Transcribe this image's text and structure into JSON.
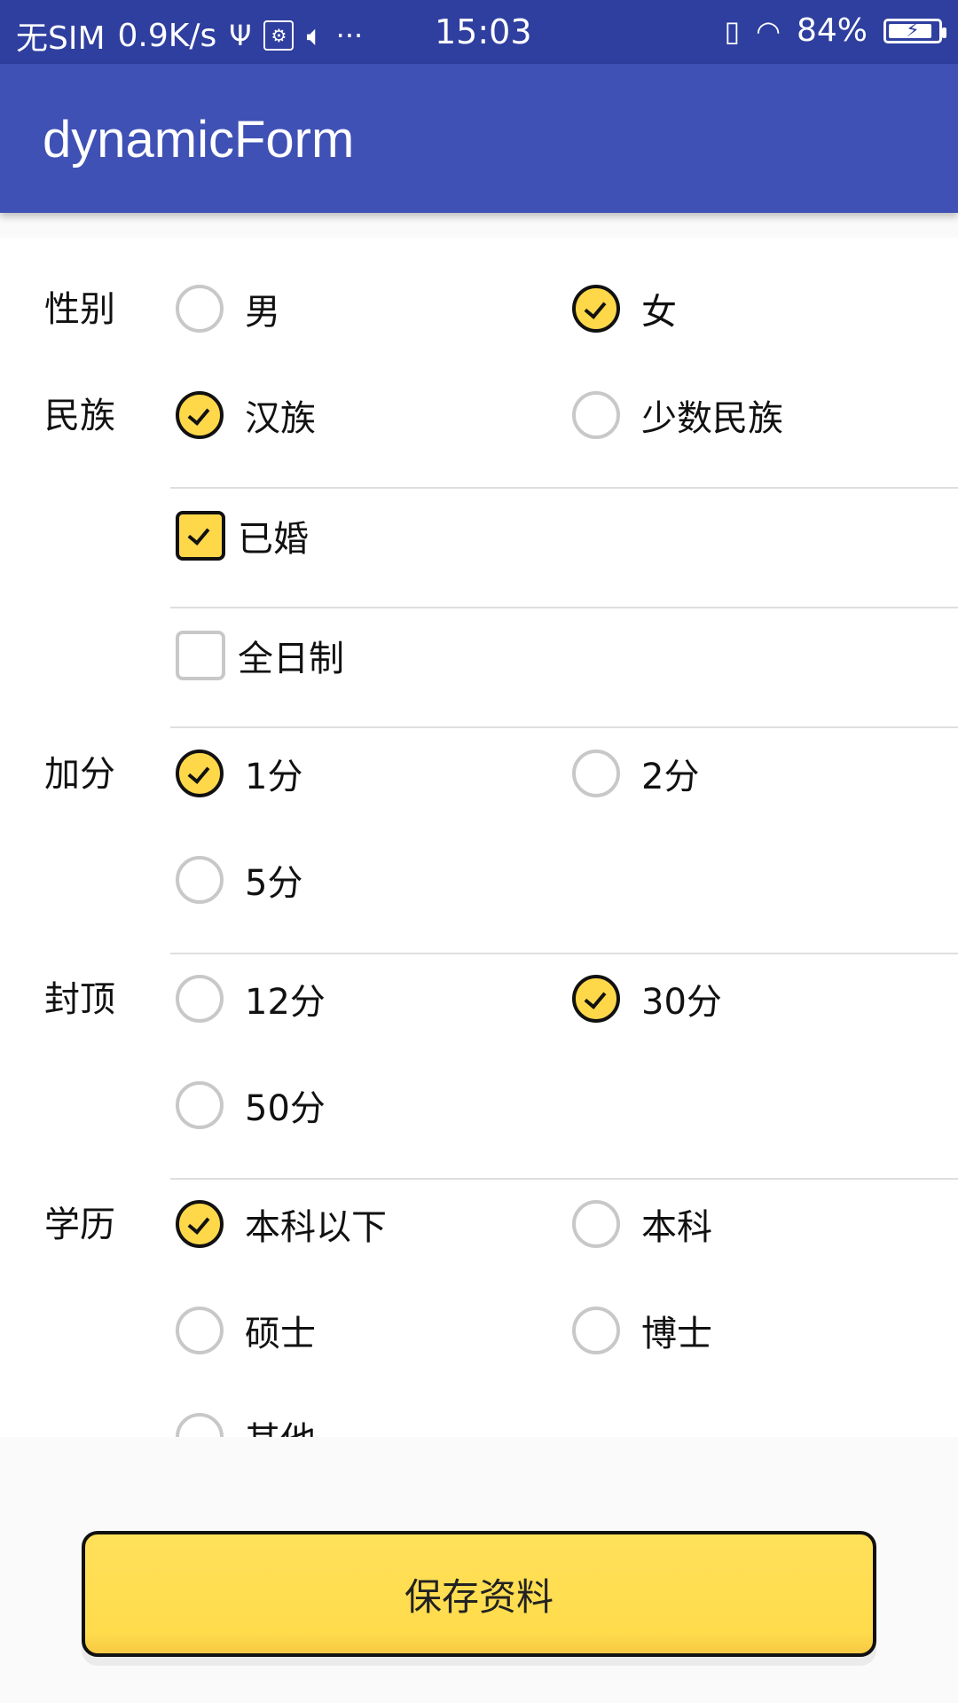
{
  "status_bar": {
    "carrier": "无SIM",
    "speed": "0.9K/s",
    "time": "15:03",
    "battery": "84%",
    "battery_level": 0.84,
    "icons": [
      "usb-icon",
      "usb-debug-icon",
      "volume-icon",
      "more-icon",
      "vibrate-icon",
      "wifi-icon",
      "battery-icon"
    ]
  },
  "app_bar": {
    "title": "dynamicForm"
  },
  "form": {
    "gender": {
      "label": "性别",
      "options": [
        "男",
        "女"
      ],
      "selected": "女"
    },
    "ethnicity": {
      "label": "民族",
      "options": [
        "汉族",
        "少数民族"
      ],
      "selected": "汉族"
    },
    "married": {
      "label": "已婚",
      "checked": true
    },
    "fulltime": {
      "label": "全日制",
      "checked": false
    },
    "bonus": {
      "label": "加分",
      "options": [
        "1分",
        "2分",
        "5分"
      ],
      "selected": "1分"
    },
    "cap": {
      "label": "封顶",
      "options": [
        "12分",
        "30分",
        "50分"
      ],
      "selected": "30分"
    },
    "education": {
      "label": "学历",
      "options": [
        "本科以下",
        "本科",
        "硕士",
        "博士",
        "其他"
      ],
      "selected": "本科以下"
    }
  },
  "save_button": {
    "label": "保存资料"
  },
  "colors": {
    "status_bar": "#2f3f9f",
    "app_bar": "#3f51b5",
    "accent": "#ffd84a",
    "border": "#111111"
  }
}
